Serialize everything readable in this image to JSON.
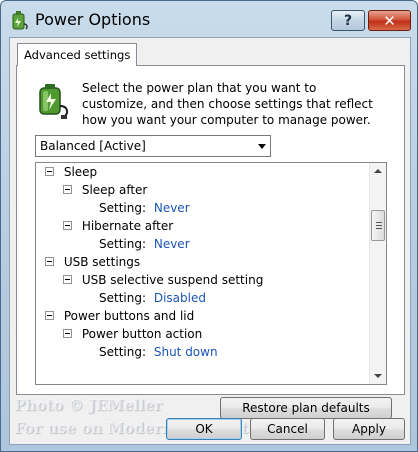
{
  "window": {
    "title": "Power Options",
    "help_label": "?",
    "close_label": "✕"
  },
  "tab": {
    "label": "Advanced settings"
  },
  "instructions": "Select the power plan that you want to customize, and then choose settings that reflect how you want your computer to manage power.",
  "plan_select": {
    "value": "Balanced [Active]"
  },
  "tree": {
    "items": [
      {
        "type": "group",
        "label": "Sleep"
      },
      {
        "type": "sub",
        "label": "Sleep after"
      },
      {
        "type": "setting",
        "label": "Setting:",
        "value": "Never"
      },
      {
        "type": "sub",
        "label": "Hibernate after"
      },
      {
        "type": "setting",
        "label": "Setting:",
        "value": "Never"
      },
      {
        "type": "group",
        "label": "USB settings"
      },
      {
        "type": "sub",
        "label": "USB selective suspend setting"
      },
      {
        "type": "setting",
        "label": "Setting:",
        "value": "Disabled"
      },
      {
        "type": "group",
        "label": "Power buttons and lid"
      },
      {
        "type": "sub",
        "label": "Power button action"
      },
      {
        "type": "setting",
        "label": "Setting:",
        "value": "Shut down"
      }
    ]
  },
  "buttons": {
    "restore": "Restore plan defaults",
    "ok": "OK",
    "cancel": "Cancel",
    "apply": "Apply"
  },
  "watermark": {
    "line1": "Photo © JEMeller",
    "line2": "For use on ModernHelp.Net"
  },
  "colors": {
    "setting_value": "#1c55b3",
    "close_button": "#c8432a",
    "frame": "#b5cbe0"
  },
  "icons": {
    "app": "battery-plug-icon",
    "plan": "battery-plug-icon"
  }
}
